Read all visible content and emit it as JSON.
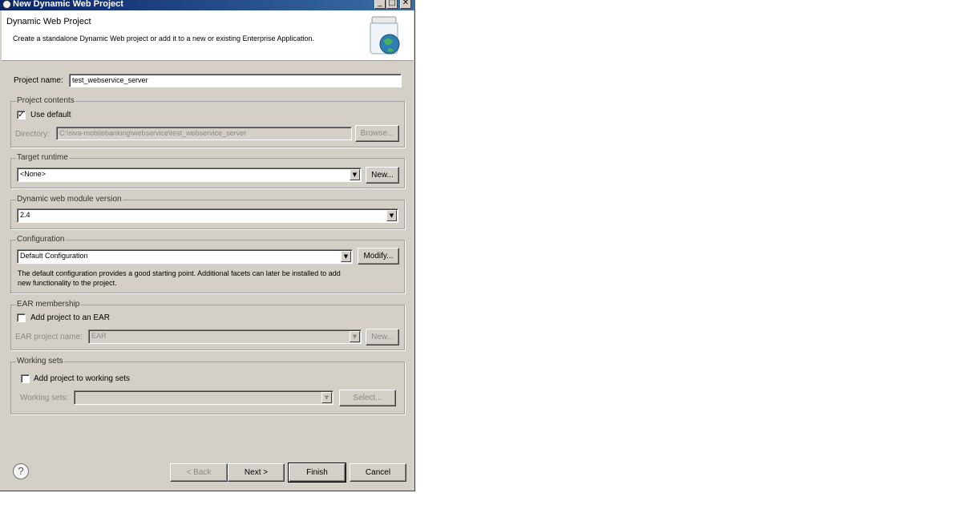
{
  "window": {
    "title": "New Dynamic Web Project",
    "minimize": "_",
    "maximize": "□",
    "close": "✕"
  },
  "header": {
    "title": "Dynamic Web Project",
    "description": "Create a standalone Dynamic Web project or add it to a new or existing Enterprise Application."
  },
  "project_name": {
    "label": "Project name:",
    "value": "test_webservice_server"
  },
  "project_contents": {
    "title": "Project contents",
    "use_default": {
      "label": "Use default",
      "checked": true
    },
    "directory": {
      "label": "Directory:",
      "value": "C:\\siva-mobilebanking\\webservice\\test_webservice_server"
    },
    "browse": "Browse..."
  },
  "target_runtime": {
    "title": "Target runtime",
    "value": "<None>",
    "new": "New..."
  },
  "module_version": {
    "title": "Dynamic web module version",
    "value": "2.4"
  },
  "configuration": {
    "title": "Configuration",
    "value": "Default Configuration",
    "modify": "Modify...",
    "description_line1": "The default configuration provides a good starting point. Additional facets can later be installed to add",
    "description_line2": "new functionality to the project."
  },
  "ear": {
    "title": "EAR membership",
    "add": {
      "label": "Add project to an EAR",
      "checked": false
    },
    "project_name_label": "EAR project name:",
    "project_name_value": "EAR",
    "new": "New..."
  },
  "working_sets": {
    "title": "Working sets",
    "add": {
      "label": "Add project to working sets",
      "checked": false
    },
    "label": "Working sets:",
    "value": "",
    "select": "Select..."
  },
  "footer": {
    "help": "?",
    "back": "< Back",
    "next": "Next >",
    "finish": "Finish",
    "cancel": "Cancel"
  }
}
